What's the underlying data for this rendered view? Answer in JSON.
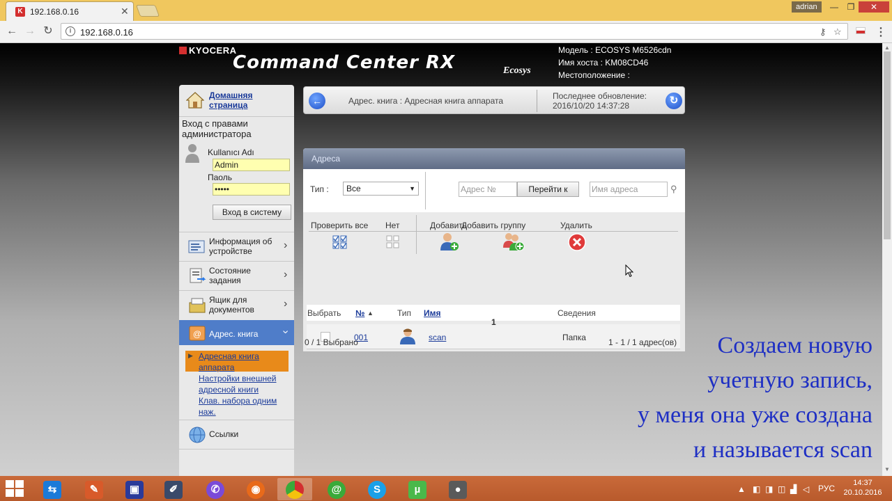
{
  "browser": {
    "tab_title": "192.168.0.16",
    "tab_close": "✕",
    "user": "adrian",
    "url": "192.168.0.16",
    "win_min": "—",
    "win_max": "❐",
    "win_close": "✕"
  },
  "header": {
    "brand": "KYOCERA",
    "product": "Command Center RX",
    "ecosys": "Ecosys",
    "model_line": "Модель : ECOSYS M6526cdn",
    "host_line": "Имя хоста : KM08CD46",
    "location_line": "Местоположение :"
  },
  "sidebar": {
    "home_link": "Домашняя страница",
    "admin_title": "Вход с правами администратора",
    "username_label": "Kullanıcı Adı",
    "username_value": "Admin",
    "password_label": "Паоль",
    "password_value": "•••••",
    "login_button": "Вход в систему",
    "items": [
      {
        "label": "Информация об устройстве",
        "icon": "device-info-icon"
      },
      {
        "label": "Состояние задания",
        "icon": "job-status-icon"
      },
      {
        "label": "Ящик для документов",
        "icon": "document-box-icon"
      },
      {
        "label": "Адрес. книга",
        "icon": "address-book-icon"
      },
      {
        "label": "Ссылки",
        "icon": "links-globe-icon"
      }
    ],
    "subitems": [
      "Адресная книга аппарата",
      "Настройки внешней адресной книги",
      "Клав. набора одним наж."
    ]
  },
  "breadcrumb": {
    "text": "Адрес. книга : Адресная книга аппарата",
    "updated_label": "Последнее обновление:",
    "updated_value": "2016/10/20 14:37:28"
  },
  "panel": {
    "title": "Адреса",
    "type_label": "Тип :",
    "type_value": "Все",
    "number_placeholder": "Адрес №",
    "goto_button": "Перейти к",
    "name_placeholder": "Имя адреса",
    "actions": {
      "check_all": "Проверить все",
      "none": "Нет",
      "add": "Добавить",
      "add_group": "Добавить группу",
      "delete": "Удалить"
    },
    "columns": [
      "Выбрать",
      "№",
      "Тип",
      "Имя",
      "Сведения"
    ],
    "rows": [
      {
        "number": "001",
        "name": "scan",
        "info": "Папка"
      }
    ],
    "page": "1",
    "selected": "0 / 1 Выбрано",
    "range": "1 - 1 / 1 адрес(ов)"
  },
  "overlay_caption": [
    "Создаем новую",
    "учетную запись,",
    "у меня она уже создана",
    "и называется scan"
  ],
  "taskbar": {
    "lang": "РУС",
    "time": "14:37",
    "date": "20.10.2016"
  },
  "colors": {
    "accent_blue": "#4f7dc9",
    "active_sub": "#e88a1a",
    "input_yellow": "#ffffb0",
    "caption_blue": "#1e2fc4",
    "titlebar": "#f0c75e",
    "taskbar": "#c96a3a"
  }
}
